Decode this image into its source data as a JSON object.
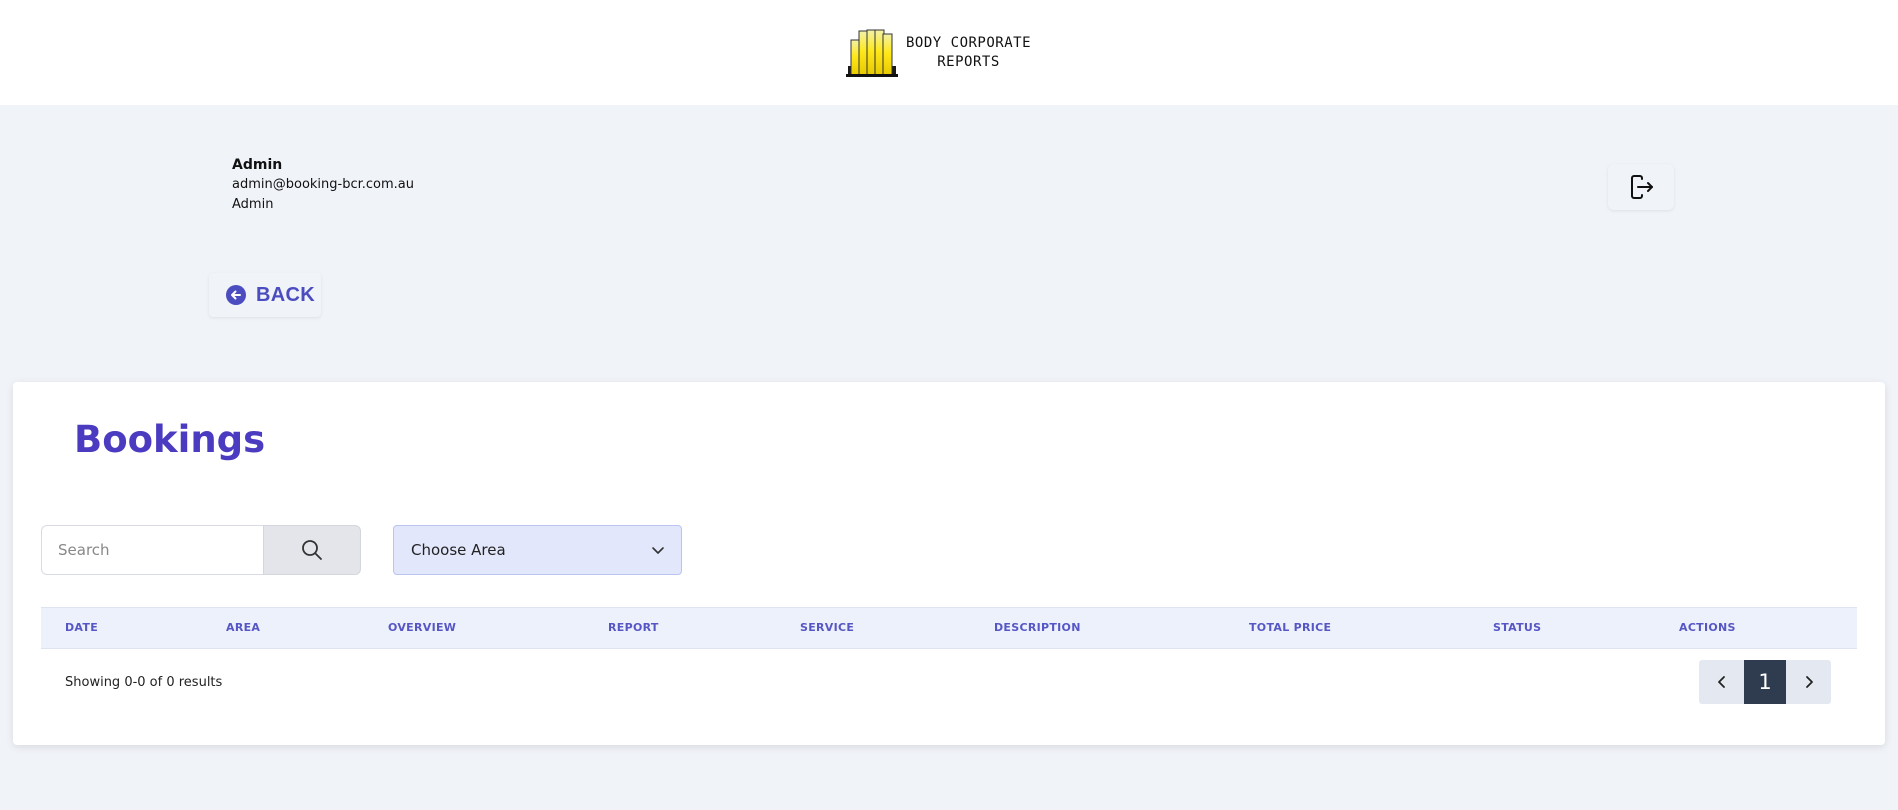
{
  "header": {
    "logo_line1": "BODY CORPORATE",
    "logo_line2": "REPORTS"
  },
  "user": {
    "name": "Admin",
    "email": "admin@booking-bcr.com.au",
    "role": "Admin"
  },
  "nav": {
    "back_label": "BACK",
    "logout_icon": "logout-icon"
  },
  "main": {
    "title": "Bookings",
    "search": {
      "placeholder": "Search",
      "value": ""
    },
    "area_select": {
      "selected": "Choose Area"
    },
    "table": {
      "columns": [
        "DATE",
        "AREA",
        "OVERVIEW",
        "REPORT",
        "SERVICE",
        "DESCRIPTION",
        "TOTAL PRICE",
        "STATUS",
        "ACTIONS"
      ],
      "rows": []
    },
    "results_text": "Showing 0-0 of 0 results",
    "pagination": {
      "current_page": "1"
    }
  },
  "colors": {
    "accent": "#4b3bc0",
    "table_header_text": "#5656c5",
    "page_bg": "#f0f3f8",
    "pager_active": "#2f3b4f"
  }
}
